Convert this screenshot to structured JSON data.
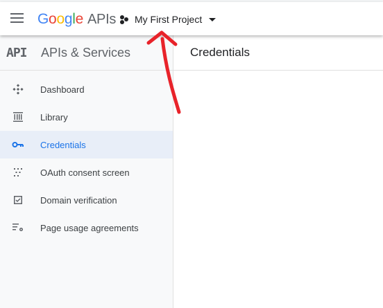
{
  "header": {
    "logo_letters": [
      {
        "ch": "G",
        "color": "#4285F4"
      },
      {
        "ch": "o",
        "color": "#EA4335"
      },
      {
        "ch": "o",
        "color": "#FBBC05"
      },
      {
        "ch": "g",
        "color": "#4285F4"
      },
      {
        "ch": "l",
        "color": "#34A853"
      },
      {
        "ch": "e",
        "color": "#EA4335"
      }
    ],
    "logo_suffix": "APIs",
    "project_label": "My First Project"
  },
  "sidebar": {
    "badge": "API",
    "title": "APIs & Services",
    "items": [
      {
        "label": "Dashboard",
        "icon": "dashboard-icon",
        "active": false
      },
      {
        "label": "Library",
        "icon": "library-icon",
        "active": false
      },
      {
        "label": "Credentials",
        "icon": "key-icon",
        "active": true
      },
      {
        "label": "OAuth consent screen",
        "icon": "oauth-consent-icon",
        "active": false
      },
      {
        "label": "Domain verification",
        "icon": "checkbox-icon",
        "active": false
      },
      {
        "label": "Page usage agreements",
        "icon": "settings-list-icon",
        "active": false
      }
    ]
  },
  "main": {
    "title": "Credentials"
  },
  "annotation": {
    "arrow_color": "#e8232a"
  }
}
